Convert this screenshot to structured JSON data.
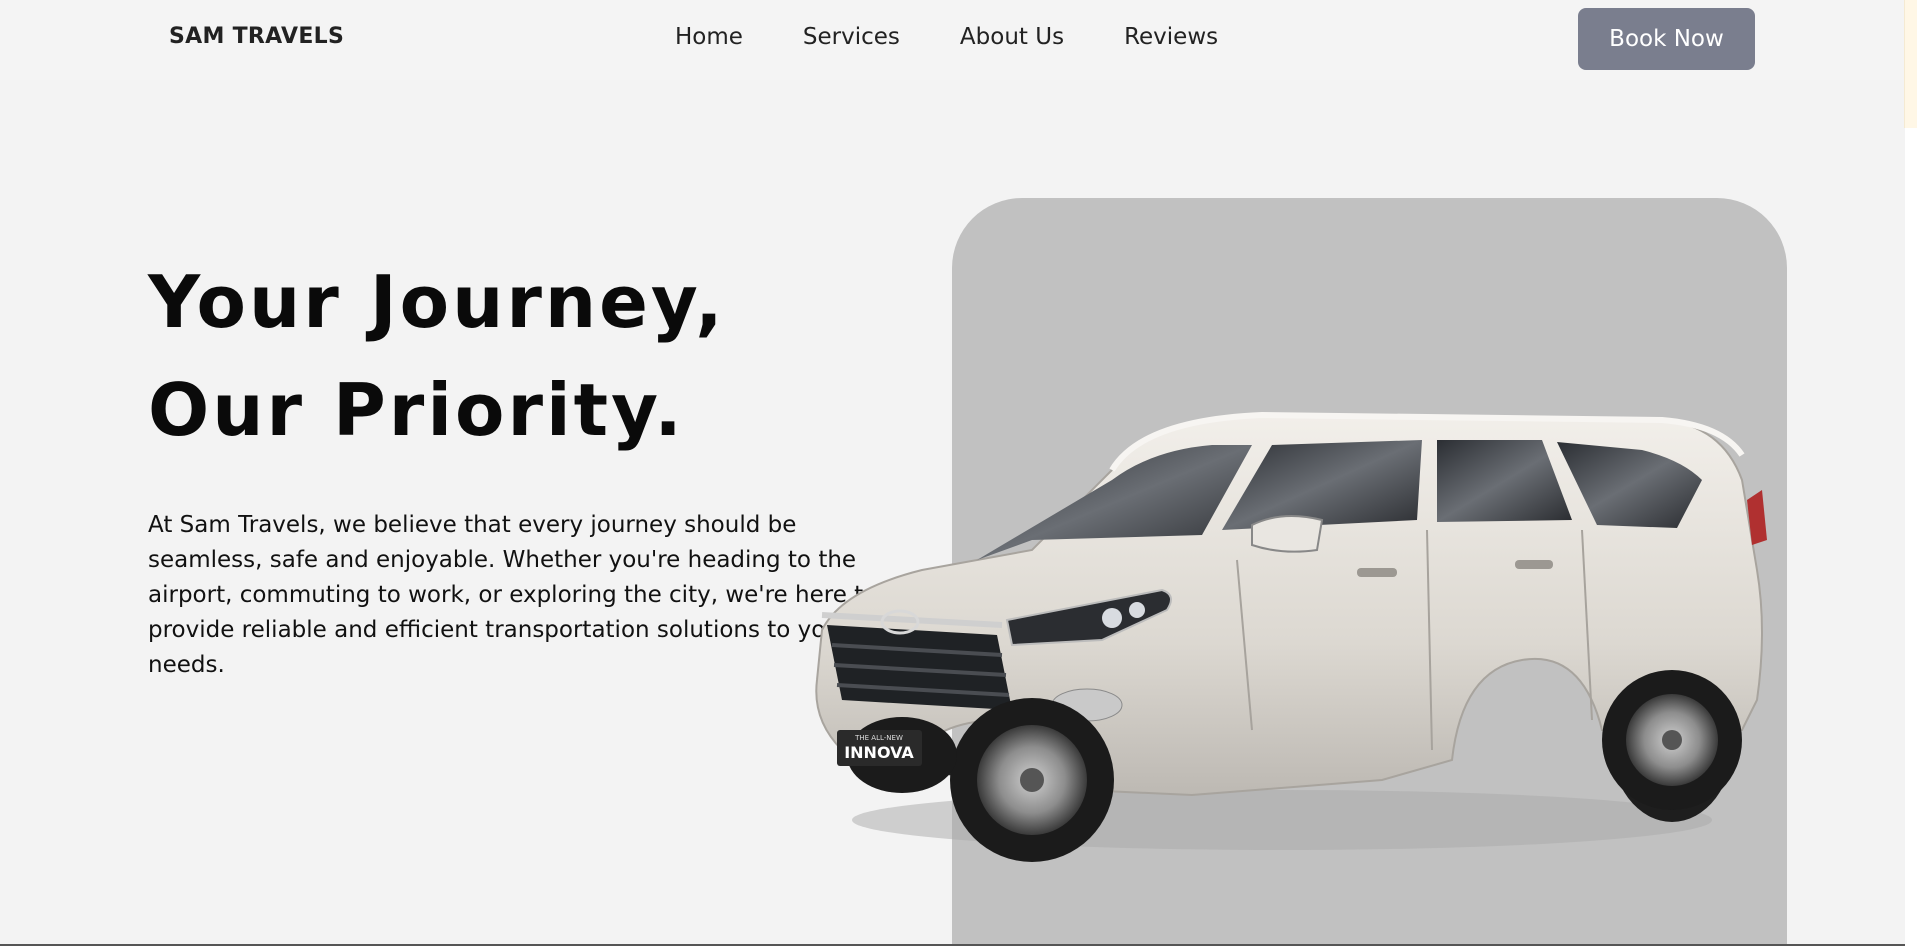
{
  "header": {
    "brand": "SAM TRAVELS",
    "nav": [
      {
        "label": "Home"
      },
      {
        "label": "Services"
      },
      {
        "label": "About Us"
      },
      {
        "label": "Reviews"
      }
    ],
    "cta_label": "Book Now"
  },
  "hero": {
    "title_line1": "Your Journey,",
    "title_line2": "Our Priority.",
    "description": "At Sam Travels, we believe that every journey should be seamless, safe and enjoyable. Whether you're heading to the airport, commuting to work, or exploring the city, we're here to provide reliable and efficient transportation solutions to your needs.",
    "car_badge": "INNOVA",
    "car_badge_small": "THE ALL-NEW"
  },
  "colors": {
    "background": "#f3f3f3",
    "button": "#7a7e8e",
    "image_panel": "#c1c1c1",
    "car_body": "#e6e2dc"
  },
  "icons": [
    "car-image",
    "toyota-logo-icon"
  ]
}
